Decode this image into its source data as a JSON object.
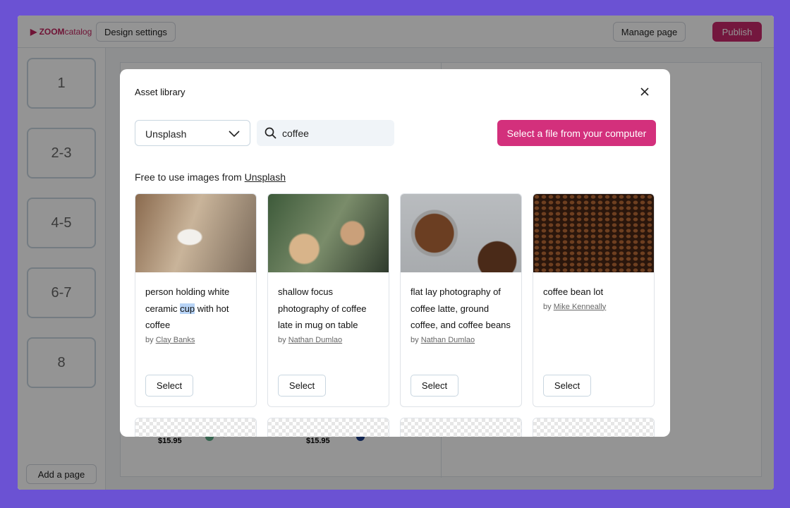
{
  "app": {
    "logo_bold": "ZOOM",
    "logo_light": "catalog",
    "design_settings": "Design settings",
    "manage_page": "Manage page",
    "publish": "Publish",
    "add_page": "Add a page",
    "pages": [
      "1",
      "2-3",
      "4-5",
      "6-7",
      "8"
    ],
    "background_items": [
      {
        "price": "$15.95",
        "color_name": "Aquamarine",
        "swatch": "#5fae8a"
      },
      {
        "price": "$15.95",
        "color_name": "Blue",
        "swatch": "#1d3f8a"
      }
    ]
  },
  "modal": {
    "title": "Asset library",
    "source": "Unsplash",
    "search_value": "coffee",
    "upload_label": "Select a file from your computer",
    "free_prefix": "Free to use images from ",
    "free_link": "Unsplash",
    "cards": [
      {
        "title_before": "person holding white ceramic ",
        "title_highlight": "cup",
        "title_after": " with hot coffee",
        "by": "by ",
        "author": "Clay Banks",
        "select": "Select"
      },
      {
        "title_before": "shallow focus photography of coffee late in mug on table",
        "title_highlight": "",
        "title_after": "",
        "by": "by ",
        "author": "Nathan Dumlao",
        "select": "Select"
      },
      {
        "title_before": "flat lay photography of coffee latte, ground coffee, and coffee beans",
        "title_highlight": "",
        "title_after": "",
        "by": "by ",
        "author": "Nathan Dumlao",
        "select": "Select"
      },
      {
        "title_before": "coffee bean lot",
        "title_highlight": "",
        "title_after": "",
        "by": "by ",
        "author": "Mike Kenneally",
        "select": "Select"
      }
    ]
  },
  "colors": {
    "frame": "#6b52d3",
    "accent": "#d3307c",
    "publish": "#c8286c"
  }
}
